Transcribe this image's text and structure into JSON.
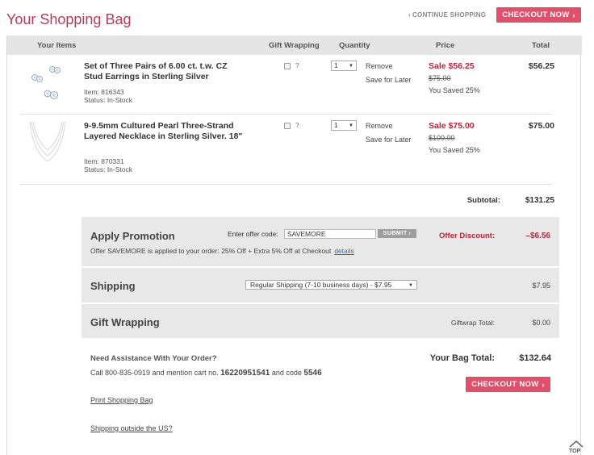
{
  "header": {
    "title": "Your Shopping Bag",
    "continue_label": "CONTINUE SHOPPING",
    "checkout_label": "CHECKOUT NOW"
  },
  "columns": {
    "items": "Your Items",
    "gift": "Gift Wrapping",
    "quantity": "Quantity",
    "price": "Price",
    "total": "Total"
  },
  "items": [
    {
      "name": "Set of Three Pairs of 6.00 ct. t.w. CZ Stud Earrings in Sterling Silver",
      "item_no": "Item: 816343",
      "status": "Status: In-Stock",
      "gift_help": "?",
      "quantity": "1",
      "remove": "Remove",
      "save_later": "Save for Later",
      "sale_price": "Sale $56.25",
      "orig_price": "$75.00",
      "saved": "You Saved 25%",
      "total": "$56.25",
      "thumb_icon": "earrings-icon"
    },
    {
      "name": "9-9.5mm Cultured Pearl Three-Strand Layered Necklace in Sterling Silver. 18\"",
      "item_no": "Item: 870331",
      "status": "Status: In-Stock",
      "gift_help": "?",
      "quantity": "1",
      "remove": "Remove",
      "save_later": "Save for Later",
      "sale_price": "Sale $75.00",
      "orig_price": "$100.00",
      "saved": "You Saved 25%",
      "total": "$75.00",
      "thumb_icon": "necklace-icon"
    }
  ],
  "subtotal": {
    "label": "Subtotal:",
    "value": "$131.25"
  },
  "promotion": {
    "title": "Apply Promotion",
    "offer_label": "Enter offer code:",
    "code": "SAVEMORE",
    "submit": "SUBMIT",
    "note": "Offer SAVEMORE is applied to your order: 25% Off + Extra 5% Off at Checkout",
    "details": "details",
    "discount_label": "Offer Discount:",
    "discount_value": "–$6.56"
  },
  "shipping": {
    "title": "Shipping",
    "selected": "Regular Shipping (7-10 business days) - $7.95",
    "value": "$7.95"
  },
  "gift_wrapping": {
    "title": "Gift Wrapping",
    "total_label": "Giftwrap Total:",
    "total_value": "$0.00"
  },
  "assist": {
    "title": "Need Assistance With Your Order?",
    "text_prefix": "Call 800-835-0919 and mention cart no.",
    "cart_no": "16220951541",
    "text_mid": "and code",
    "code": "5546"
  },
  "bag_total": {
    "label": "Your Bag Total:",
    "value": "$132.64"
  },
  "links": {
    "print": "Print Shopping Bag",
    "outside_us": "Shipping outside the US?"
  },
  "top_label": "TOP",
  "colors": {
    "accent": "#e0506b",
    "title": "#b83a5a",
    "sale": "#b8263c",
    "panel": "#e8e8e8"
  }
}
